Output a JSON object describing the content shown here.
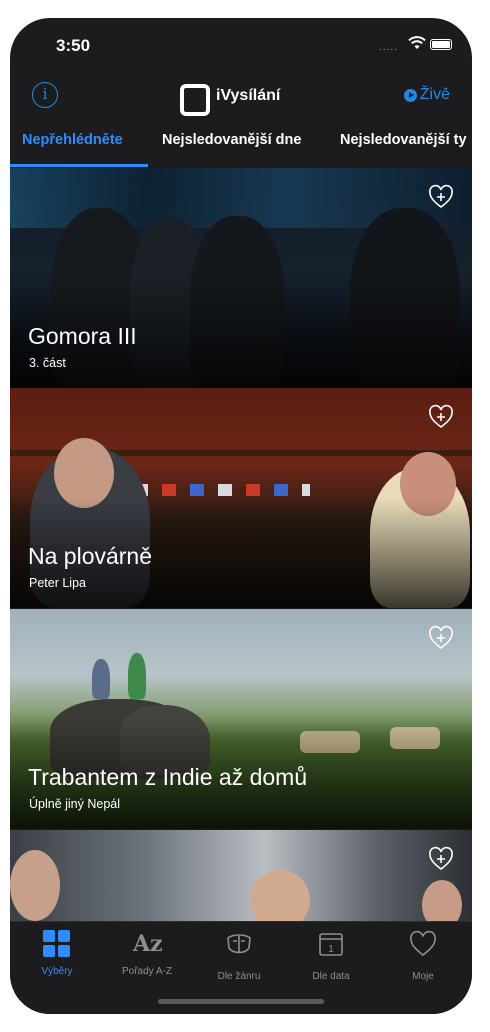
{
  "status_bar": {
    "time": "3:50",
    "signal": "....."
  },
  "nav": {
    "logo_text": "iVysílání",
    "live_label": "Živě"
  },
  "tabs": [
    {
      "label": "Nepřehlédněte",
      "active": true
    },
    {
      "label": "Nejsledovanější dne",
      "active": false
    },
    {
      "label": "Nejsledovanější ty",
      "active": false
    }
  ],
  "cards": [
    {
      "title": "Gomora III",
      "subtitle": "3. část"
    },
    {
      "title": "Na plovárně",
      "subtitle": "Peter Lipa"
    },
    {
      "title": "Trabantem z Indie až domů",
      "subtitle": "Úplně jiný Nepál"
    },
    {
      "title": "",
      "subtitle": ""
    }
  ],
  "tab_bar": [
    {
      "label": "Výběry",
      "icon": "grid-icon",
      "active": true
    },
    {
      "label": "Pořady A-Z",
      "icon": "az-icon",
      "active": false
    },
    {
      "label": "Dle žánru",
      "icon": "genre-icon",
      "active": false
    },
    {
      "label": "Dle data",
      "icon": "calendar-icon",
      "active": false,
      "icon_text": "1"
    },
    {
      "label": "Moje",
      "icon": "heart-icon",
      "active": false
    }
  ],
  "colors": {
    "accent": "#2f8cff",
    "background": "#1c1c1e"
  }
}
